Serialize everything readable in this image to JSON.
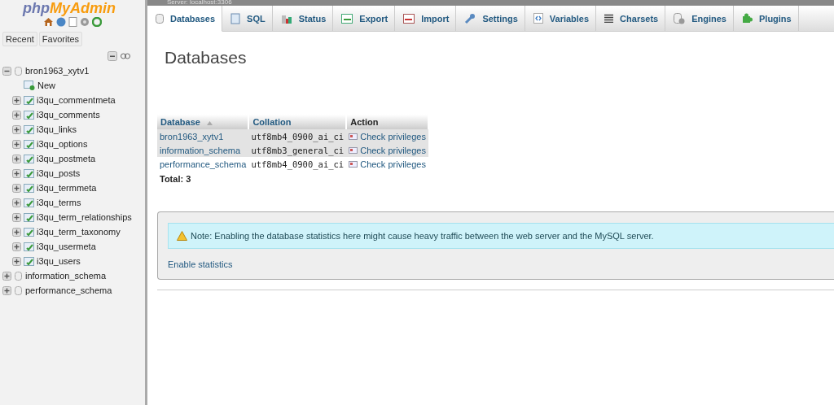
{
  "logo": {
    "part1": "php",
    "part2": "MyAdmin"
  },
  "nav_tabs": [
    {
      "label": "Recent"
    },
    {
      "label": "Favorites"
    }
  ],
  "tree": [
    {
      "name": "bron1963_xytv1",
      "expanded": true,
      "children": [
        {
          "kind": "new",
          "name": "New"
        },
        {
          "kind": "table",
          "name": "i3qu_commentmeta"
        },
        {
          "kind": "table",
          "name": "i3qu_comments"
        },
        {
          "kind": "table",
          "name": "i3qu_links"
        },
        {
          "kind": "table",
          "name": "i3qu_options"
        },
        {
          "kind": "table",
          "name": "i3qu_postmeta"
        },
        {
          "kind": "table",
          "name": "i3qu_posts"
        },
        {
          "kind": "table",
          "name": "i3qu_termmeta"
        },
        {
          "kind": "table",
          "name": "i3qu_terms"
        },
        {
          "kind": "table",
          "name": "i3qu_term_relationships"
        },
        {
          "kind": "table",
          "name": "i3qu_term_taxonomy"
        },
        {
          "kind": "table",
          "name": "i3qu_usermeta"
        },
        {
          "kind": "table",
          "name": "i3qu_users"
        }
      ]
    },
    {
      "name": "information_schema",
      "expanded": false
    },
    {
      "name": "performance_schema",
      "expanded": false
    }
  ],
  "breadcrumb": "Server: localhost:3306",
  "tabs": [
    {
      "label": "Databases",
      "selected": true
    },
    {
      "label": "SQL",
      "selected": false
    },
    {
      "label": "Status",
      "selected": false
    },
    {
      "label": "Export",
      "selected": false
    },
    {
      "label": "Import",
      "selected": false
    },
    {
      "label": "Settings",
      "selected": false
    },
    {
      "label": "Variables",
      "selected": false
    },
    {
      "label": "Charsets",
      "selected": false
    },
    {
      "label": "Engines",
      "selected": false
    },
    {
      "label": "Plugins",
      "selected": false
    }
  ],
  "heading": "Databases",
  "table": {
    "columns": [
      "Database",
      "Collation",
      "Action"
    ],
    "rows": [
      {
        "database": "bron1963_xytv1",
        "collation": "utf8mb4_0900_ai_ci",
        "action": "Check privileges",
        "selected": true
      },
      {
        "database": "information_schema",
        "collation": "utf8mb3_general_ci",
        "action": "Check privileges",
        "selected": true
      },
      {
        "database": "performance_schema",
        "collation": "utf8mb4_0900_ai_ci",
        "action": "Check privileges",
        "selected": false
      }
    ],
    "total": "Total: 3"
  },
  "note": "Note: Enabling the database statistics here might cause heavy traffic between the web server and the MySQL server.",
  "enable_link": "Enable statistics"
}
